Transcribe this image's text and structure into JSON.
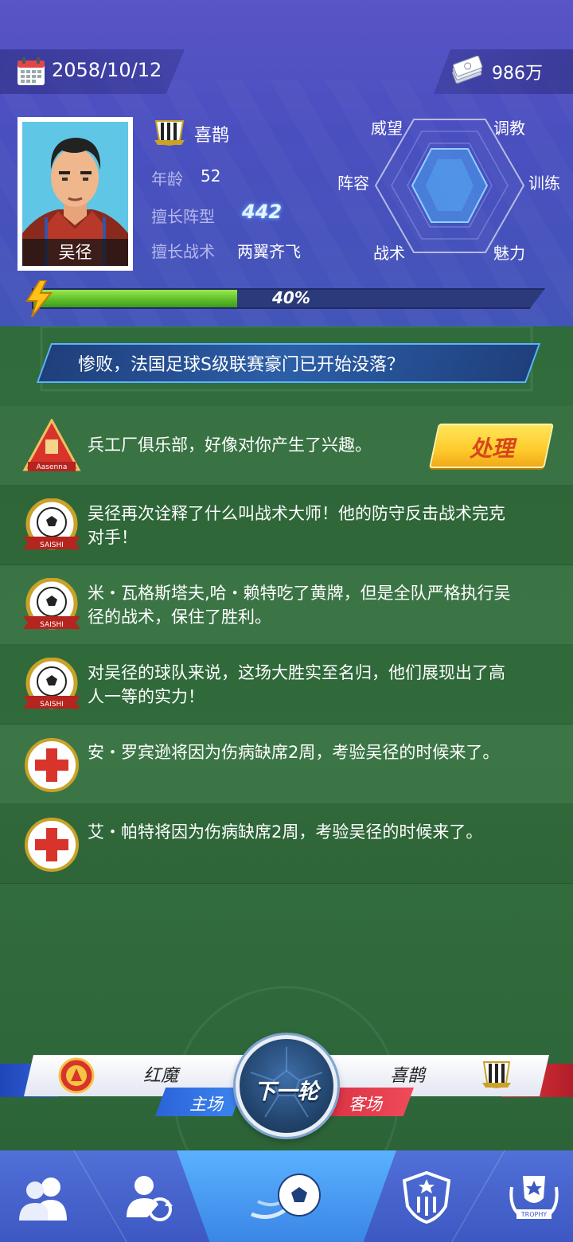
{
  "header": {
    "date": "2058/10/12",
    "money": "986万",
    "manager": {
      "name": "吴径",
      "club": "喜鹊",
      "age_label": "年龄",
      "age": "52",
      "formation_label": "擅长阵型",
      "formation": "442",
      "tactic_label": "擅长战术",
      "tactic": "两翼齐飞"
    },
    "radar": {
      "labels": {
        "prestige": "威望",
        "training_adjust": "调教",
        "lineup": "阵容",
        "training": "训练",
        "tactics": "战术",
        "charm": "魅力"
      }
    },
    "energy": {
      "percent": 40,
      "text": "40%"
    }
  },
  "headline": "惨败，法国足球S级联赛豪门已开始没落？",
  "news": [
    {
      "icon": "arsenal-crest-icon",
      "icon_text": "Aasenna",
      "text": "兵工厂俱乐部，好像对你产生了兴趣。",
      "action": "处理"
    },
    {
      "icon": "saishi-ball-icon",
      "icon_text": "SAISHI",
      "text": "吴径再次诠释了什么叫战术大师！他的防守反击战术完克对手！"
    },
    {
      "icon": "saishi-ball-icon",
      "icon_text": "SAISHI",
      "text": "米・瓦格斯塔夫,哈・赖特吃了黄牌，但是全队严格执行吴径的战术，保住了胜利。"
    },
    {
      "icon": "saishi-ball-icon",
      "icon_text": "SAISHI",
      "text": "对吴径的球队来说，这场大胜实至名归，他们展现出了高人一等的实力！"
    },
    {
      "icon": "red-cross-icon",
      "text": "安・罗宾逊将因为伤病缺席2周，考验吴径的时候来了。"
    },
    {
      "icon": "red-cross-icon",
      "text": "艾・帕特将因为伤病缺席2周，考验吴径的时候来了。"
    }
  ],
  "match": {
    "home_team": "红魔",
    "home_label": "主场",
    "away_team": "喜鹊",
    "away_label": "客场",
    "next_round": "下一轮"
  },
  "nav": {
    "items": [
      "team-icon",
      "transfer-icon",
      "match-icon",
      "league-icon",
      "trophy-icon"
    ],
    "trophy_text": "TROPHY"
  },
  "colors": {
    "header": "#4a4fc0",
    "pitch": "#2f6a3c",
    "energy": "#5fbf2b",
    "action_button": "#ffcb2b",
    "home": "#2a63d8",
    "away": "#d83244"
  }
}
